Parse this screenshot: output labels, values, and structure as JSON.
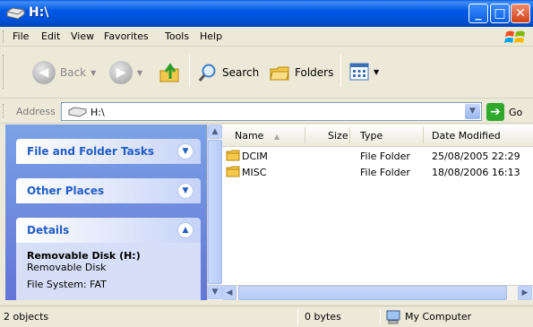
{
  "window": {
    "title": "H:\\"
  },
  "menu": {
    "items": [
      "File",
      "Edit",
      "View",
      "Favorites",
      "Tools",
      "Help"
    ]
  },
  "toolbar": {
    "back_label": "Back",
    "search_label": "Search",
    "folders_label": "Folders"
  },
  "address": {
    "label": "Address",
    "value": "H:\\",
    "go_label": "Go"
  },
  "taskpane": {
    "file_tasks_title": "File and Folder Tasks",
    "other_places_title": "Other Places",
    "details_title": "Details",
    "details_name": "Removable Disk (H:)",
    "details_type": "Removable Disk",
    "details_fs": "File System: FAT"
  },
  "filelist": {
    "columns": [
      "Name",
      "Size",
      "Type",
      "Date Modified"
    ],
    "rows": [
      {
        "name": "DCIM",
        "size": "",
        "type": "File Folder",
        "date": "25/08/2005 22:29"
      },
      {
        "name": "MISC",
        "size": "",
        "type": "File Folder",
        "date": "18/08/2006 16:13"
      }
    ]
  },
  "statusbar": {
    "objects": "2 objects",
    "size": "0 bytes",
    "location": "My Computer"
  },
  "colors": {
    "title_blue": "#0058e6",
    "task_header_text": "#215dc6",
    "folder_yellow": "#f2c94c"
  }
}
